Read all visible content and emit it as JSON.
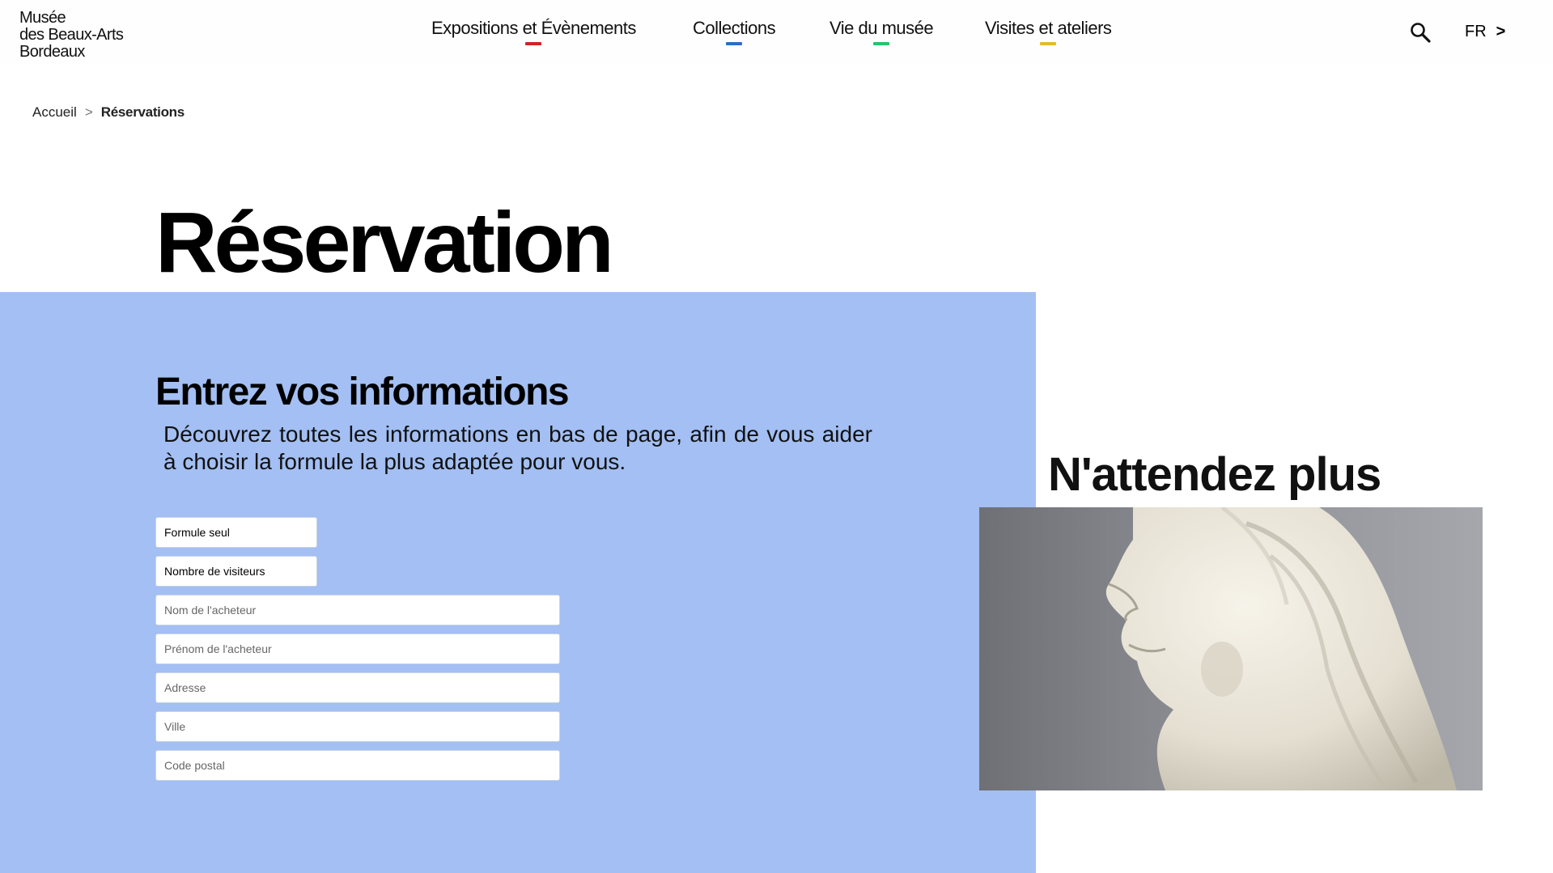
{
  "header": {
    "logo_lines": [
      "Musée",
      "des Beaux-Arts",
      "Bordeaux"
    ],
    "nav": [
      {
        "label": "Expositions et Évènements",
        "color": "#d5202e"
      },
      {
        "label": "Collections",
        "color": "#2a6fc0"
      },
      {
        "label": "Vie du musée",
        "color": "#26c46a"
      },
      {
        "label": "Visites et ateliers",
        "color": "#e0bd2a"
      }
    ],
    "search_icon": "search-icon",
    "language": "FR",
    "language_chevron": ">"
  },
  "breadcrumb": {
    "home": "Accueil",
    "separator": ">",
    "current": "Réservations"
  },
  "page_title": "Réservation",
  "form": {
    "title": "Entrez vos informations",
    "description": "Découvrez toutes les informations en bas de page, afin de vous aider à choisir la formule la plus adaptée pour vous.",
    "panel_color": "#a3bff3",
    "selects": {
      "formula": "Formule seul",
      "visitors": "Nombre de visiteurs"
    },
    "placeholders": {
      "buyer_last_name": "Nom de l'acheteur",
      "buyer_first_name": "Prénom de l'acheteur",
      "address": "Adresse",
      "city": "Ville",
      "postal_code": "Code postal"
    }
  },
  "side": {
    "title": "N'attendez plus",
    "image_subject": "marble bust sculpture"
  }
}
